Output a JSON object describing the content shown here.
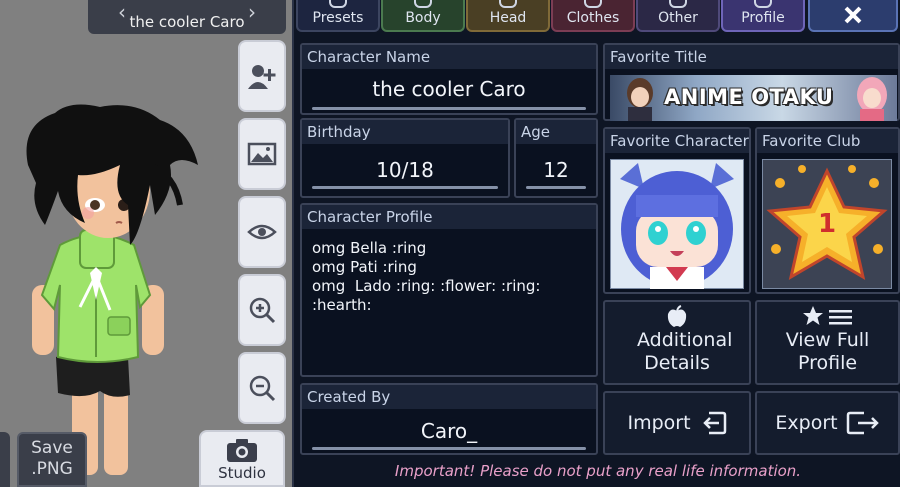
{
  "character": {
    "name_header": "the cooler Caro"
  },
  "tabs": [
    {
      "label": "Presets"
    },
    {
      "label": "Body"
    },
    {
      "label": "Head"
    },
    {
      "label": "Clothes"
    },
    {
      "label": "Other"
    },
    {
      "label": "Profile"
    }
  ],
  "side_buttons": [
    {
      "icon": "add-user-icon"
    },
    {
      "icon": "image-icon"
    },
    {
      "icon": "eye-icon"
    },
    {
      "icon": "zoom-in-icon"
    },
    {
      "icon": "zoom-out-icon"
    }
  ],
  "save_button": {
    "line1": "Save",
    "line2": ".PNG"
  },
  "studio_button": {
    "label": "Studio"
  },
  "profile": {
    "name_title": "Character Name",
    "name_value": "the cooler Caro",
    "birthday_title": "Birthday",
    "birthday_value": "10/18",
    "age_title": "Age",
    "age_value": "12",
    "profile_title": "Character Profile",
    "profile_text": "omg Bella :ring\nomg Pati :ring\nomg  Lado :ring: :flower: :ring:\n:hearth:",
    "created_by_title": "Created By",
    "created_by_value": "Caro_",
    "fav_title_title": "Favorite Title",
    "fav_title_banner": "ANIME OTAKU",
    "fav_character_title": "Favorite Character",
    "fav_club_title": "Favorite Club",
    "fav_club_badge": "1",
    "additional_details": "Additional Details",
    "view_full_profile": "View Full Profile",
    "import_label": "Import",
    "export_label": "Export",
    "warning": "Important! Please do not put any real life information."
  },
  "colors": {
    "panel_bg": "#0e1524",
    "warning": "#e9a0c9",
    "tab_profile": "#3a3470"
  }
}
